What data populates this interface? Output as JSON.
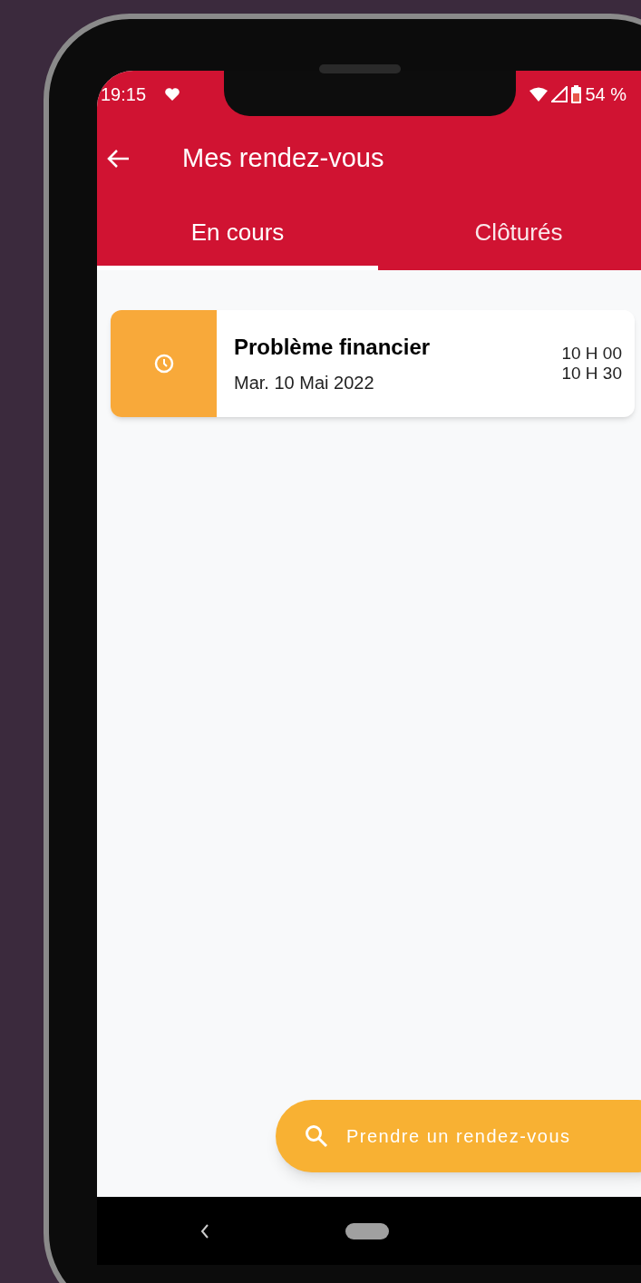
{
  "status_bar": {
    "time": "19:15",
    "battery": "54 %"
  },
  "app_bar": {
    "title": "Mes rendez-vous"
  },
  "tabs": [
    {
      "label": "En cours",
      "selected": true
    },
    {
      "label": "Clôturés",
      "selected": false
    }
  ],
  "appointments": [
    {
      "title": "Problème financier",
      "date": "Mar. 10 Mai 2022",
      "start": "10 H 00",
      "end": "10 H 30"
    }
  ],
  "fab": {
    "label": "Prendre un rendez-vous"
  }
}
